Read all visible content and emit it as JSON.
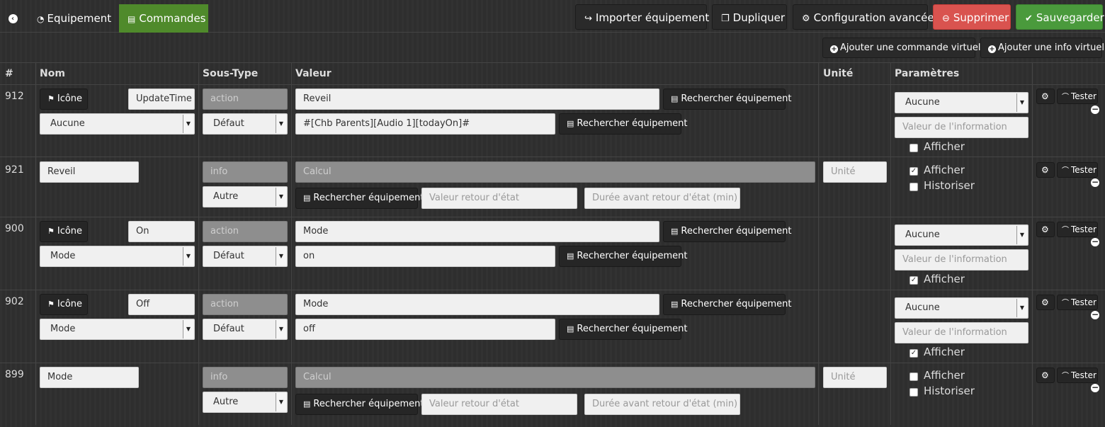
{
  "topbar": {
    "tabs": [
      {
        "label": "Equipement",
        "icon": "dashboard-icon"
      },
      {
        "label": "Commandes",
        "icon": "list-icon"
      }
    ],
    "actions": [
      {
        "label": "Importer équipement",
        "icon": "share-icon"
      },
      {
        "label": "Dupliquer",
        "icon": "copy-icon"
      },
      {
        "label": "Configuration avancée",
        "icon": "cogs-icon"
      },
      {
        "label": "Supprimer",
        "icon": "minus-circle-icon",
        "color": "#d9534f"
      },
      {
        "label": "Sauvegarder",
        "icon": "check-circle-icon",
        "color": "#4a9a3c"
      }
    ],
    "active_tab_color": "#4f8a2b"
  },
  "subactions": {
    "add_virtual_command": "Ajouter une commande virtuelle",
    "add_virtual_info": "Ajouter une info virtuelle"
  },
  "table": {
    "headers": {
      "id": "#",
      "name": "Nom",
      "subtype": "Sous-Type",
      "value": "Valeur",
      "unit": "Unité",
      "params": "Paramètres"
    },
    "search_label": "Rechercher équipement",
    "icon_label": "Icône",
    "test_label": "Tester",
    "rows": [
      {
        "id": "912",
        "name": "UpdateTime",
        "type": "action",
        "subtype": "Défaut",
        "scope": "Aucune",
        "value1": "Reveil",
        "value2": "#[Chb Parents][Audio 1][todayOn]#",
        "param_select": "Aucune",
        "param_info_placeholder": "Valeur de l'information",
        "show_label": "Afficher",
        "show_checked": false
      },
      {
        "id": "921",
        "name": "Reveil",
        "type": "info",
        "subtype": "Autre",
        "calc_placeholder": "Calcul",
        "unit_placeholder": "Unité",
        "state_return_placeholder": "Valeur retour d'état",
        "delay_placeholder": "Durée avant retour d'état (min)",
        "show_label": "Afficher",
        "show_checked": true,
        "history_label": "Historiser",
        "history_checked": false
      },
      {
        "id": "900",
        "name": "On",
        "type": "action",
        "subtype": "Défaut",
        "scope": "Mode",
        "value1": "Mode",
        "value2": "on",
        "param_select": "Aucune",
        "param_info_placeholder": "Valeur de l'information",
        "show_label": "Afficher",
        "show_checked": true
      },
      {
        "id": "902",
        "name": "Off",
        "type": "action",
        "subtype": "Défaut",
        "scope": "Mode",
        "value1": "Mode",
        "value2": "off",
        "param_select": "Aucune",
        "param_info_placeholder": "Valeur de l'information",
        "show_label": "Afficher",
        "show_checked": true
      },
      {
        "id": "899",
        "name": "Mode",
        "type": "info",
        "subtype": "Autre",
        "calc_placeholder": "Calcul",
        "unit_placeholder": "Unité",
        "state_return_placeholder": "Valeur retour d'état",
        "delay_placeholder": "Durée avant retour d'état (min)",
        "show_label": "Afficher",
        "show_checked": false,
        "history_label": "Historiser",
        "history_checked": false
      }
    ]
  }
}
